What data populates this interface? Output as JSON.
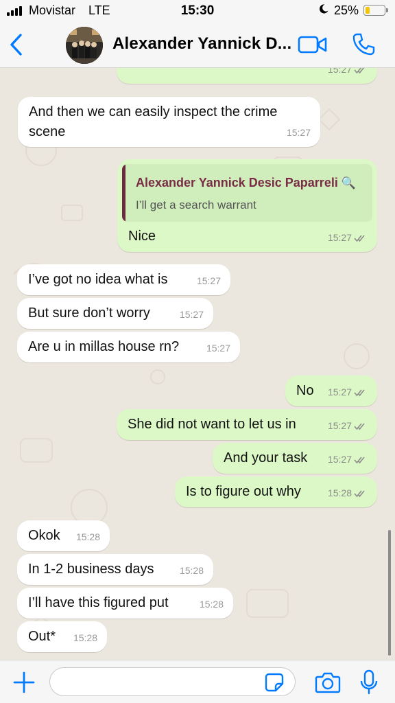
{
  "status_bar": {
    "carrier": "Movistar",
    "network": "LTE",
    "time": "15:30",
    "battery_percent": "25%",
    "battery_level": 0.25,
    "icons": [
      "signal-bars-icon",
      "moon-icon",
      "battery-icon"
    ]
  },
  "header": {
    "title": "Alexander Yannick D...",
    "icons": [
      "back-chevron-icon",
      "avatar",
      "video-call-icon",
      "phone-call-icon"
    ]
  },
  "messages": [
    {
      "dir": "out",
      "time": "15:27",
      "status": "read"
    },
    {
      "dir": "in",
      "text": "And then we can easily inspect the crime scene",
      "time": "15:27"
    },
    {
      "dir": "out",
      "quote_author": "Alexander Yannick Desic Paparreli",
      "quote_icon": "🔍",
      "quote_text": "I’ll get a search warrant",
      "text": "Nice",
      "time": "15:27",
      "status": "read"
    },
    {
      "dir": "in",
      "text": "I’ve got no idea what is",
      "time": "15:27"
    },
    {
      "dir": "in",
      "text": "But sure don’t worry",
      "time": "15:27"
    },
    {
      "dir": "in",
      "text": "Are u in millas house rn?",
      "time": "15:27"
    },
    {
      "dir": "out",
      "text": "No",
      "time": "15:27",
      "status": "read"
    },
    {
      "dir": "out",
      "text": "She did not want to let us in",
      "time": "15:27",
      "status": "read"
    },
    {
      "dir": "out",
      "text": "And your task",
      "time": "15:27",
      "status": "read"
    },
    {
      "dir": "out",
      "text": "Is to figure out why",
      "time": "15:28",
      "status": "read"
    },
    {
      "dir": "in",
      "text": "Okok",
      "time": "15:28"
    },
    {
      "dir": "in",
      "text": "In 1-2 business days",
      "time": "15:28"
    },
    {
      "dir": "in",
      "text": "I’ll have this figured put",
      "time": "15:28"
    },
    {
      "dir": "in",
      "text": "Out*",
      "time": "15:28"
    }
  ],
  "input_bar": {
    "placeholder": "",
    "icons": [
      "plus-icon",
      "sticker-icon",
      "camera-icon",
      "microphone-icon"
    ]
  },
  "colors": {
    "accent": "#007aff",
    "outgoing_bubble": "#dcf8c6",
    "incoming_bubble": "#ffffff",
    "chat_background": "#ebe6de",
    "read_ticks": "#8c8c8c",
    "quote_author": "#7a2c46"
  }
}
